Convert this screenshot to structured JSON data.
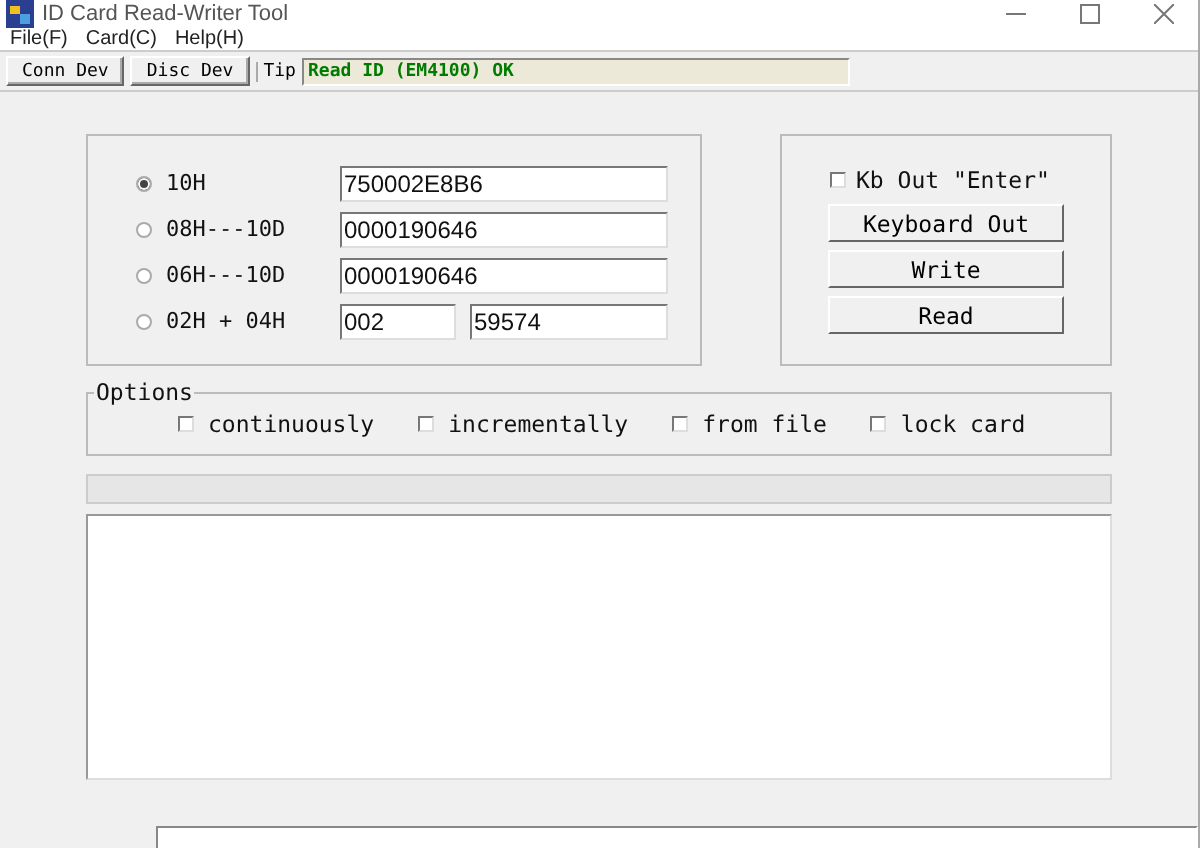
{
  "window": {
    "title": "ID Card Read-Writer Tool"
  },
  "menu": [
    "File(F)",
    "Card(C)",
    "Help(H)"
  ],
  "toolbar": {
    "buttons": [
      "Conn Dev",
      "Disc Dev"
    ],
    "tip_label": "Tip",
    "tip_text": "Read ID (EM4100) OK"
  },
  "formats": [
    {
      "label": "10H",
      "selected": true,
      "values": [
        "750002E8B6"
      ]
    },
    {
      "label": "08H---10D",
      "selected": false,
      "values": [
        "0000190646"
      ]
    },
    {
      "label": "06H---10D",
      "selected": false,
      "values": [
        "0000190646"
      ]
    },
    {
      "label": "02H + 04H",
      "selected": false,
      "values": [
        "002",
        "59574"
      ]
    }
  ],
  "kb_enter": {
    "label": "Kb Out \"Enter\"",
    "checked": false
  },
  "actions": [
    "Keyboard Out",
    "Write",
    "Read"
  ],
  "options": {
    "title": "Options",
    "items": [
      {
        "label": "continuously",
        "checked": false
      },
      {
        "label": "incrementally",
        "checked": false
      },
      {
        "label": "from file",
        "checked": false
      },
      {
        "label": "lock card",
        "checked": false
      }
    ]
  }
}
